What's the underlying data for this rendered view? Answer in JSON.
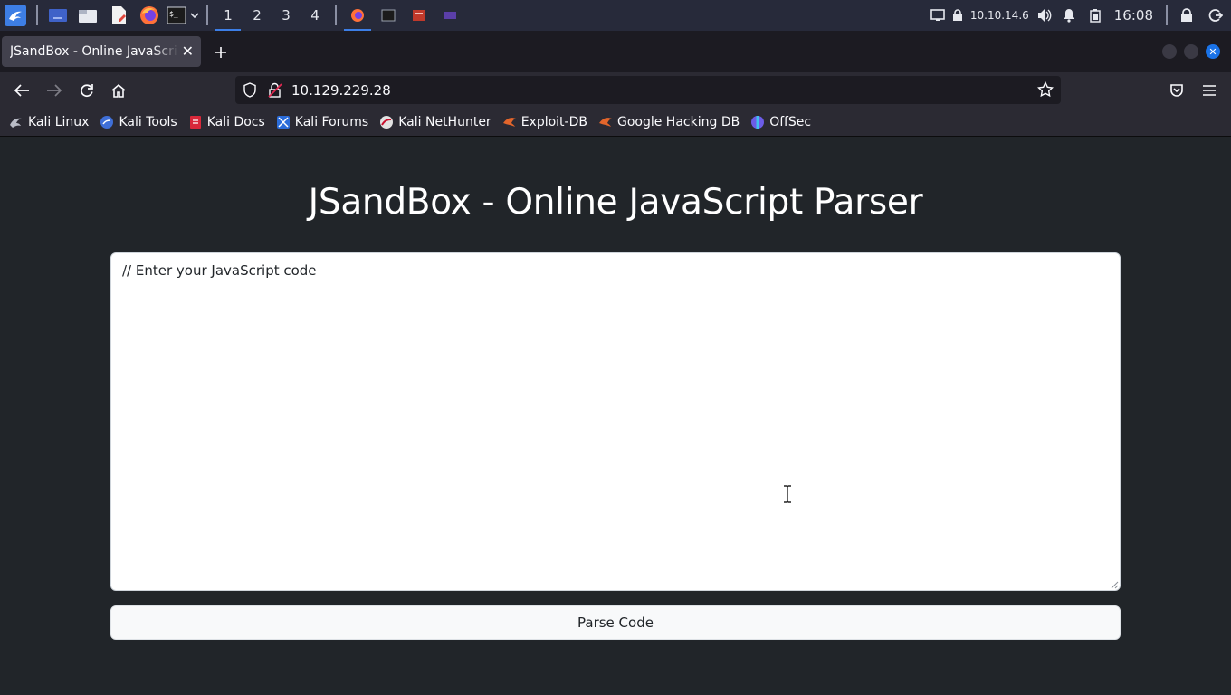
{
  "taskbar": {
    "workspaces": [
      "1",
      "2",
      "3",
      "4"
    ],
    "tray": {
      "ip": "10.10.14.6",
      "clock": "16:08"
    }
  },
  "browser": {
    "tab": {
      "title": "JSandBox - Online JavaScript Parser"
    },
    "url": "10.129.229.28",
    "bookmarks": [
      {
        "label": "Kali Linux",
        "icon": "kali-icon"
      },
      {
        "label": "Kali Tools",
        "icon": "kali-tools-icon"
      },
      {
        "label": "Kali Docs",
        "icon": "kali-docs-icon"
      },
      {
        "label": "Kali Forums",
        "icon": "kali-forums-icon"
      },
      {
        "label": "Kali NetHunter",
        "icon": "nethunter-icon"
      },
      {
        "label": "Exploit-DB",
        "icon": "exploit-db-icon"
      },
      {
        "label": "Google Hacking DB",
        "icon": "ghdb-icon"
      },
      {
        "label": "OffSec",
        "icon": "offsec-icon"
      }
    ]
  },
  "page": {
    "title": "JSandBox - Online JavaScript Parser",
    "editor": {
      "placeholder": "// Enter your JavaScript code",
      "value": ""
    },
    "parse_button": "Parse Code"
  },
  "colors": {
    "page_background": "#212529",
    "taskbar": "#272a3a",
    "accent": "#3c7ee6"
  }
}
